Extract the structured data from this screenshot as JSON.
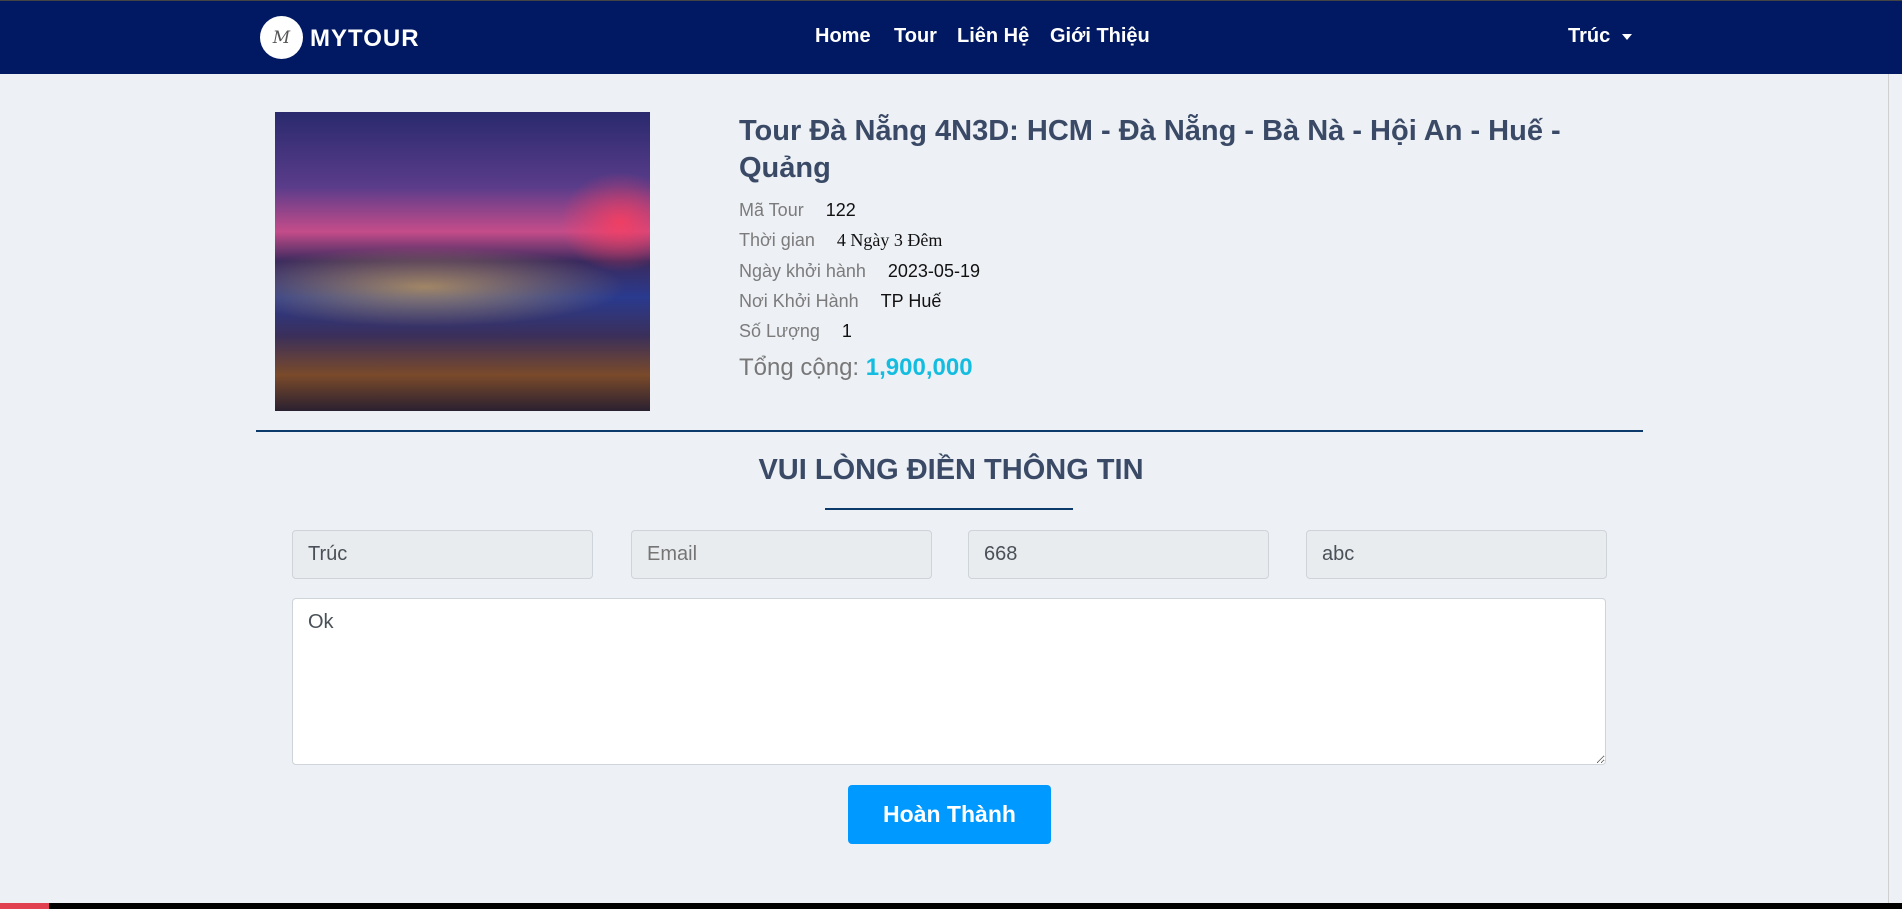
{
  "navbar": {
    "logo_text": "M",
    "brand": "MYTOUR",
    "links": [
      "Home",
      "Tour",
      "Liên Hệ",
      "Giới Thiệu"
    ],
    "user": "Trúc"
  },
  "tour": {
    "title": "Tour Đà Nẵng 4N3D: HCM - Đà Nẵng - Bà Nà - Hội An - Huế - Quảng",
    "details": [
      {
        "label": "Mã Tour",
        "value": "122"
      },
      {
        "label": "Thời gian",
        "value": "4 Ngày 3 Đêm"
      },
      {
        "label": "Ngày khởi hành",
        "value": "2023-05-19"
      },
      {
        "label": "Nơi Khởi Hành",
        "value": "TP Huế"
      },
      {
        "label": "Số Lượng",
        "value": "1"
      }
    ],
    "total_label": "Tổng cộng:",
    "total_value": "1,900,000"
  },
  "form": {
    "heading": "VUI LÒNG ĐIỀN THÔNG TIN",
    "name_value": "Trúc",
    "email_placeholder": "Email",
    "phone_value": "668",
    "address_value": "abc",
    "note_value": "Ok",
    "submit_label": "Hoàn Thành"
  },
  "colors": {
    "navbar": "#011862",
    "accent": "#0099ff",
    "price": "#14bde0"
  }
}
